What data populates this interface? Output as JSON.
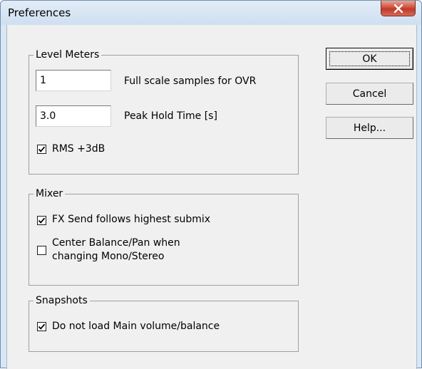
{
  "window": {
    "title": "Preferences",
    "close_icon": "close-icon"
  },
  "level_meters": {
    "group_label": "Level Meters",
    "ovr_samples_value": "1",
    "ovr_samples_label": "Full scale samples for OVR",
    "peak_hold_value": "3.0",
    "peak_hold_label": "Peak Hold Time [s]",
    "rms_label": "RMS +3dB",
    "rms_checked": true
  },
  "mixer": {
    "group_label": "Mixer",
    "fx_send_label": "FX Send follows highest submix",
    "fx_send_checked": true,
    "center_balance_label_line1": "Center Balance/Pan when",
    "center_balance_label_line2": "changing Mono/Stereo",
    "center_balance_checked": false
  },
  "snapshots": {
    "group_label": "Snapshots",
    "no_load_main_label": "Do not load Main volume/balance",
    "no_load_main_checked": true
  },
  "buttons": {
    "ok_label": "OK",
    "cancel_label": "Cancel",
    "help_label": "Help..."
  }
}
